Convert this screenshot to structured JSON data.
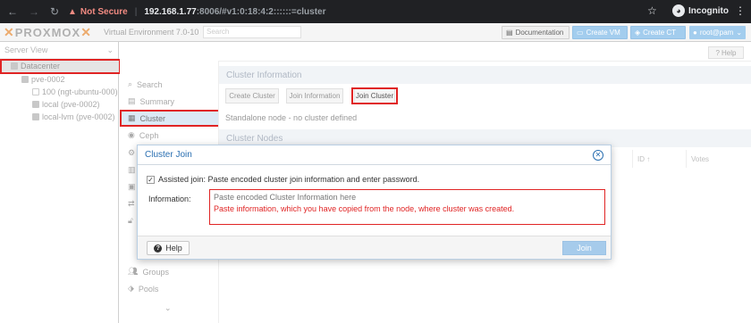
{
  "browser": {
    "warning_label": "Not Secure",
    "url_host": "192.168.1.77",
    "url_rest": ":8006/#v1:0:18:4:2::::::=cluster",
    "incognito_label": "Incognito"
  },
  "header": {
    "logo_text": "PROXMOX",
    "version": "Virtual Environment 7.0-10",
    "search_placeholder": "Search",
    "documentation": "Documentation",
    "create_vm": "Create VM",
    "create_ct": "Create CT",
    "user": "root@pam"
  },
  "tree": {
    "title": "Server View",
    "datacenter": "Datacenter",
    "node": "pve-0002",
    "vm": "100 (ngt-ubuntu-000)",
    "storage1": "local (pve-0002)",
    "storage2": "local-lvm (pve-0002)"
  },
  "breadcrumb": "Datacenter",
  "help_label": "Help",
  "nav": {
    "search": "Search",
    "summary": "Summary",
    "cluster": "Cluster",
    "ceph": "Ceph",
    "groups": "Groups",
    "pools": "Pools"
  },
  "cluster_info": {
    "title": "Cluster Information",
    "create": "Create Cluster",
    "join_info": "Join Information",
    "join": "Join Cluster",
    "standalone": "Standalone node - no cluster defined"
  },
  "cluster_nodes": {
    "title": "Cluster Nodes",
    "col_id": "ID ↑",
    "col_votes": "Votes"
  },
  "dialog": {
    "title": "Cluster Join",
    "assisted_label": "Assisted join: Paste encoded cluster join information and enter password.",
    "info_label": "Information:",
    "info_placeholder": "Paste encoded Cluster Information here",
    "annotation": "Paste information, which you have copied from the node, where cluster was created.",
    "help": "Help",
    "join": "Join"
  }
}
